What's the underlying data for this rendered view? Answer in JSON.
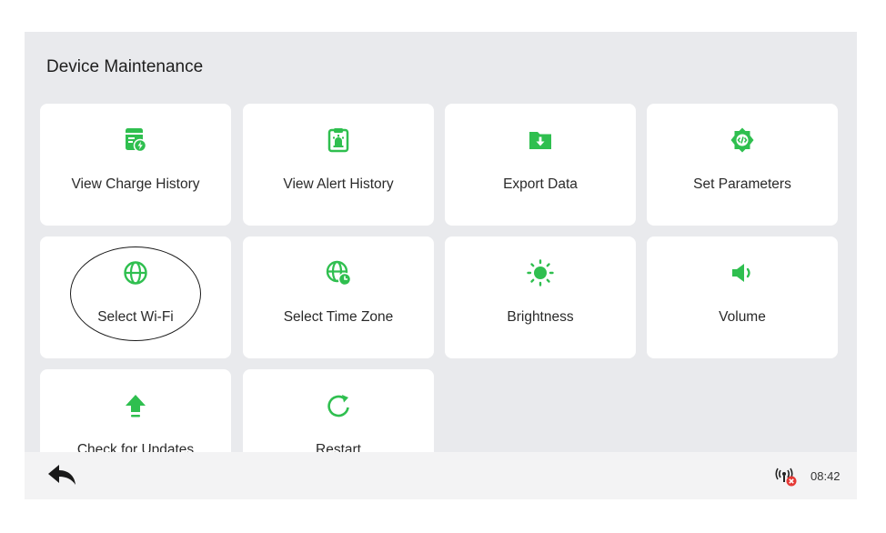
{
  "page": {
    "title": "Device Maintenance"
  },
  "colors": {
    "accent": "#2fbf4f",
    "tile": "#ffffff",
    "background": "#e9eaed",
    "alert": "#e53935"
  },
  "tiles": [
    {
      "label": "View Charge History",
      "icon": "charge-history-icon"
    },
    {
      "label": "View Alert History",
      "icon": "alert-history-icon"
    },
    {
      "label": "Export Data",
      "icon": "export-folder-icon"
    },
    {
      "label": "Set Parameters",
      "icon": "settings-gear-icon"
    },
    {
      "label": "Select Wi-Fi",
      "icon": "globe-icon"
    },
    {
      "label": "Select Time Zone",
      "icon": "globe-clock-icon"
    },
    {
      "label": "Brightness",
      "icon": "sun-icon"
    },
    {
      "label": "Volume",
      "icon": "speaker-icon"
    },
    {
      "label": "Check for Updates",
      "icon": "upload-arrow-icon"
    },
    {
      "label": "Restart",
      "icon": "restart-icon"
    }
  ],
  "status_bar": {
    "time": "08:42",
    "network_icon": "no-network-icon",
    "back_icon": "back-arrow-icon"
  }
}
